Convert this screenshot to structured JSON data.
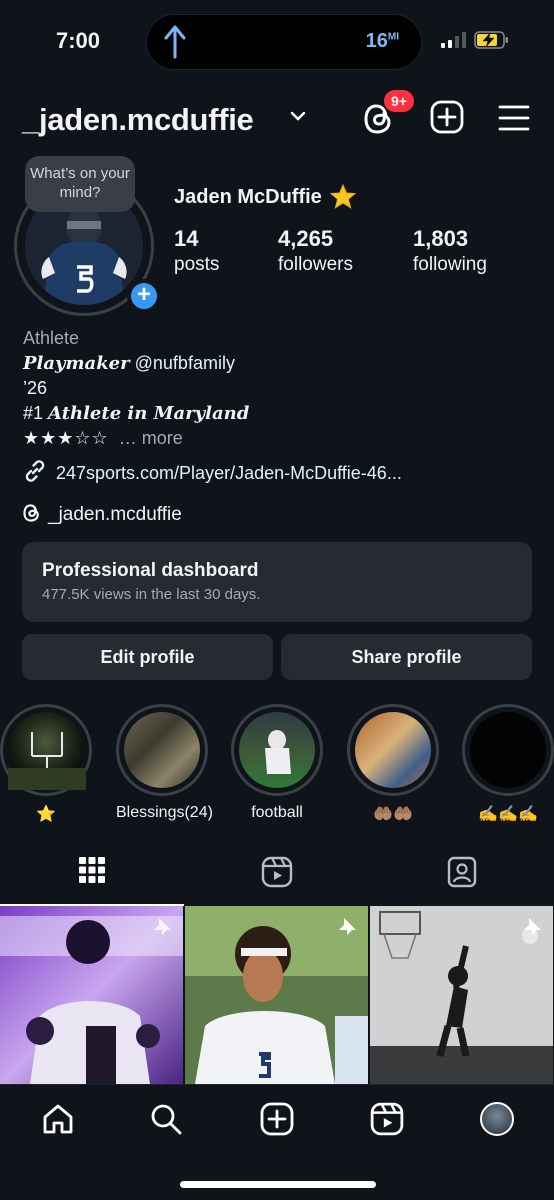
{
  "status": {
    "time": "7:00",
    "distance": "16",
    "distance_unit": "MI"
  },
  "header": {
    "username": "_jaden.mcduffie",
    "badge": "9+"
  },
  "profile": {
    "bubble_text": "What’s on your mind?",
    "display_name": "Jaden McDuffie",
    "stats": [
      {
        "value": "14",
        "label": "posts"
      },
      {
        "value": "4,265",
        "label": "followers"
      },
      {
        "value": "1,803",
        "label": "following"
      }
    ]
  },
  "bio": {
    "category": "Athlete",
    "line1_script": "Playmaker",
    "line1_mention": "@nufbfamily",
    "line2": "’26",
    "line3_prefix": "#1",
    "line3_script": "Athlete in Maryland",
    "rating_stars": "★★★☆☆",
    "more": "more",
    "link": "247sports.com/Player/Jaden-McDuffie-46...",
    "threads_handle": "_jaden.mcduffie"
  },
  "dashboard": {
    "title": "Professional dashboard",
    "subtitle": "477.5K views in the last 30 days."
  },
  "buttons": {
    "edit": "Edit profile",
    "share": "Share profile"
  },
  "highlights": [
    {
      "label": "⭐"
    },
    {
      "label": "Blessings(24)"
    },
    {
      "label": "football"
    },
    {
      "label": "🤲🏽🤲🏽"
    },
    {
      "label": "✍️✍️✍️"
    }
  ],
  "colors": {
    "accent": "#3897f0",
    "badge": "#ff3040",
    "background": "#0f131a",
    "surface": "#262a31"
  }
}
